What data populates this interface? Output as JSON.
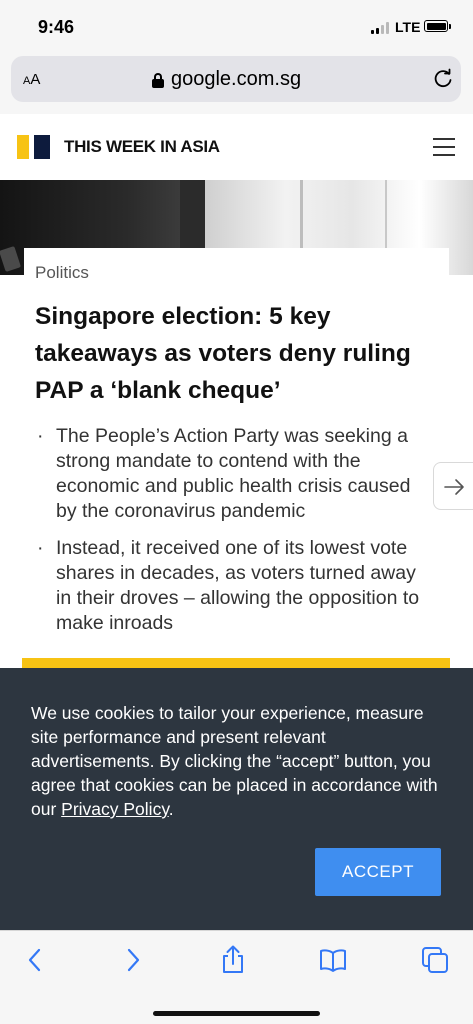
{
  "status_bar": {
    "time": "9:46",
    "network": "LTE",
    "signal_bars_filled": 2,
    "signal_bars_total": 4,
    "battery_level": 1.0
  },
  "browser": {
    "text_size_label_small": "A",
    "text_size_label_large": "A",
    "domain": "google.com.sg",
    "lock_icon": "lock-icon",
    "reload_icon": "reload-icon"
  },
  "site_header": {
    "title": "THIS WEEK IN ASIA",
    "logo_colors": [
      "#f7c314",
      "#0d1b3d"
    ],
    "menu_icon": "hamburger-menu-icon"
  },
  "article": {
    "category": "Politics",
    "headline": "Singapore election: 5 key takeaways as voters deny ruling PAP a ‘blank cheque’",
    "bullets": [
      "The People’s Action Party was seeking a strong mandate to contend with the economic and public health crisis caused by the coronavirus pandemic",
      "Instead, it received one of its lowest vote shares in decades, as voters turned away in their droves – allowing the opposition to make inroads"
    ],
    "bullet_glyph": "·",
    "next_icon": "arrow-right-icon"
  },
  "cookie_banner": {
    "text_before_link": "We use cookies to tailor your experience, measure site performance and present relevant advertisements. By clicking the “accept” button, you agree that cookies can be placed in accordance with our ",
    "link_text": "Privacy Policy",
    "text_after_link": ".",
    "accept_label": "ACCEPT",
    "accept_color": "#3f8ef0",
    "background_color": "#2d3640"
  },
  "toolbar": {
    "icons": [
      "back-icon",
      "forward-icon",
      "share-icon",
      "bookmarks-icon",
      "tabs-icon"
    ],
    "accent_color": "#3478f6"
  }
}
